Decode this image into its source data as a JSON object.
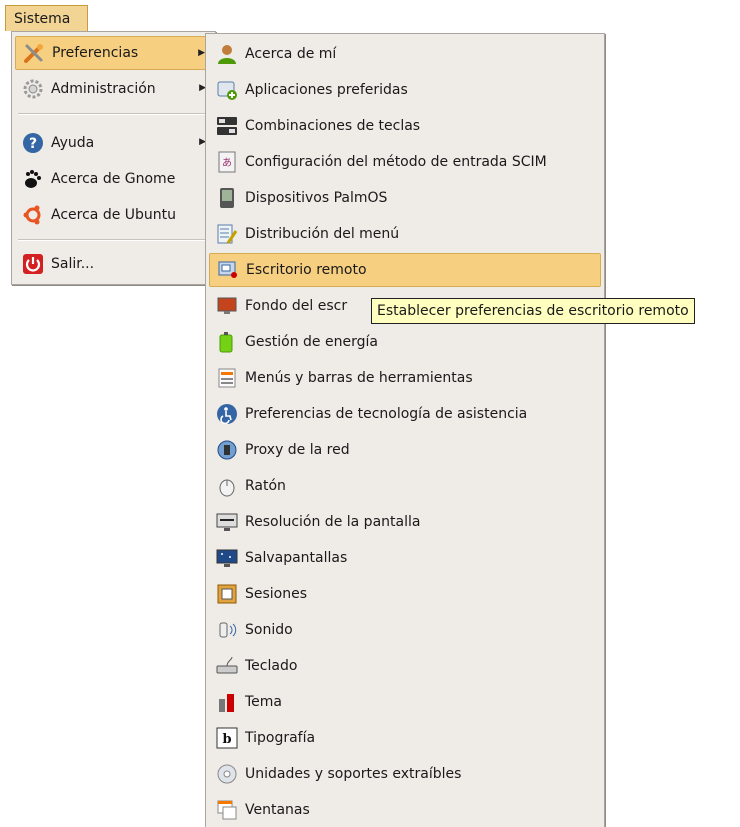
{
  "menubar": {
    "label": "Sistema"
  },
  "main_menu": {
    "items": [
      {
        "label": "Preferencias",
        "icon": "preferences-icon",
        "submenu": true
      },
      {
        "label": "Administración",
        "icon": "gear-icon",
        "submenu": true
      },
      {
        "label": "Ayuda",
        "icon": "help-icon",
        "submenu": true
      },
      {
        "label": "Acerca de Gnome",
        "icon": "gnome-foot-icon"
      },
      {
        "label": "Acerca de Ubuntu",
        "icon": "ubuntu-logo-icon"
      },
      {
        "label": "Salir...",
        "icon": "power-icon"
      }
    ]
  },
  "sub_menu": {
    "items": [
      {
        "label": "Acerca de mí",
        "icon": "user-icon"
      },
      {
        "label": "Aplicaciones preferidas",
        "icon": "preferred-apps-icon"
      },
      {
        "label": "Combinaciones de teclas",
        "icon": "keyboard-shortcuts-icon"
      },
      {
        "label": "Configuración del método de entrada SCIM",
        "icon": "scim-icon"
      },
      {
        "label": "Dispositivos PalmOS",
        "icon": "palm-device-icon"
      },
      {
        "label": "Distribución del menú",
        "icon": "menu-layout-icon"
      },
      {
        "label": "Escritorio remoto",
        "icon": "remote-desktop-icon"
      },
      {
        "label": "Fondo del escr",
        "icon": "desktop-background-icon"
      },
      {
        "label": "Gestión de energía",
        "icon": "battery-icon"
      },
      {
        "label": "Menús y barras de herramientas",
        "icon": "toolbars-icon"
      },
      {
        "label": "Preferencias de tecnología de asistencia",
        "icon": "accessibility-icon"
      },
      {
        "label": "Proxy de la red",
        "icon": "network-proxy-icon"
      },
      {
        "label": "Ratón",
        "icon": "mouse-icon"
      },
      {
        "label": "Resolución de la pantalla",
        "icon": "display-resolution-icon"
      },
      {
        "label": "Salvapantallas",
        "icon": "screensaver-icon"
      },
      {
        "label": "Sesiones",
        "icon": "sessions-icon"
      },
      {
        "label": "Sonido",
        "icon": "sound-icon"
      },
      {
        "label": "Teclado",
        "icon": "keyboard-icon"
      },
      {
        "label": "Tema",
        "icon": "theme-icon"
      },
      {
        "label": "Tipografía",
        "icon": "font-icon"
      },
      {
        "label": "Unidades y soportes extraíbles",
        "icon": "removable-media-icon"
      },
      {
        "label": "Ventanas",
        "icon": "windows-icon"
      }
    ]
  },
  "tooltip": {
    "text": "Establecer preferencias de escritorio remoto"
  },
  "colors": {
    "highlight": "#f7cf80",
    "menu_bg": "#efebe7",
    "tooltip_bg": "#ffffbf"
  }
}
